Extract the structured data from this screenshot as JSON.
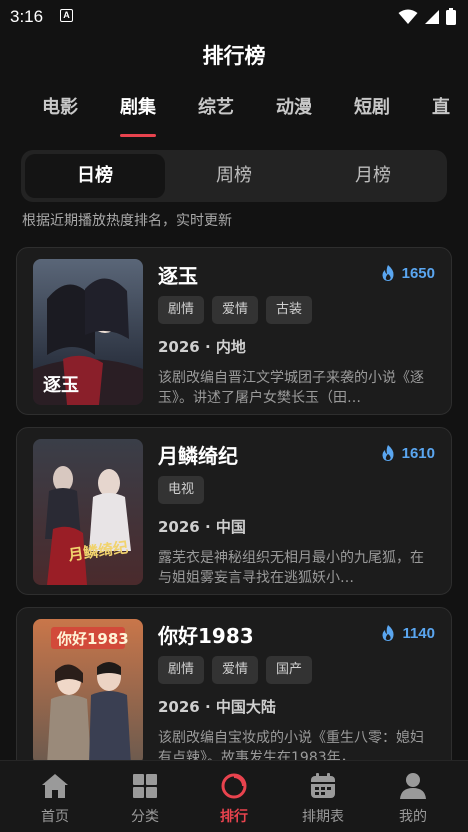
{
  "status": {
    "time": "3:16",
    "a_badge": "A"
  },
  "header": {
    "title": "排行榜"
  },
  "category_tabs": [
    {
      "label": "电影",
      "active": false
    },
    {
      "label": "剧集",
      "active": true
    },
    {
      "label": "综艺",
      "active": false
    },
    {
      "label": "动漫",
      "active": false
    },
    {
      "label": "短剧",
      "active": false
    },
    {
      "label": "直",
      "active": false
    }
  ],
  "period_tabs": [
    {
      "label": "日榜",
      "active": true
    },
    {
      "label": "周榜",
      "active": false
    },
    {
      "label": "月榜",
      "active": false
    }
  ],
  "hint": "根据近期播放热度排名，实时更新",
  "items": [
    {
      "title": "逐玉",
      "heat": "1650",
      "tags": [
        "剧情",
        "爱情",
        "古装"
      ],
      "meta": "2026 · 内地",
      "description": "该剧改编自晋江文学城团子来袭的小说《逐玉》。讲述了屠户女樊长玉（田…",
      "poster_text": "逐玉",
      "colors": {
        "top": "#5a6678",
        "bottom": "#1a1f2b"
      }
    },
    {
      "title": "月鳞绮纪",
      "heat": "1610",
      "tags": [
        "电视"
      ],
      "meta": "2026 · 中国",
      "description": "露芜衣是神秘组织无相月最小的九尾狐，在与姐姐雾妄言寻找在逃狐妖小…",
      "poster_text": "月鳞绮纪",
      "colors": {
        "top": "#3a3e48",
        "bottom": "#4a2a2c"
      }
    },
    {
      "title": "你好1983",
      "heat": "1140",
      "tags": [
        "剧情",
        "爱情",
        "国产"
      ],
      "meta": "2026 · 中国大陆",
      "description": "该剧改编自宝妆成的小说《重生八零：媳妇有点辣》。故事发生在1983年，…",
      "poster_text": "你好1983",
      "colors": {
        "top": "#c9764a",
        "bottom": "#6b5a4e"
      }
    }
  ],
  "bottom_nav": [
    {
      "label": "首页",
      "icon": "home-icon",
      "active": false
    },
    {
      "label": "分类",
      "icon": "grid-icon",
      "active": false
    },
    {
      "label": "排行",
      "icon": "ranking-icon",
      "active": true
    },
    {
      "label": "排期表",
      "icon": "calendar-icon",
      "active": false
    },
    {
      "label": "我的",
      "icon": "profile-icon",
      "active": false
    }
  ],
  "colors": {
    "accent": "#e8434e",
    "heat": "#5aa6f0",
    "background": "#121212"
  }
}
